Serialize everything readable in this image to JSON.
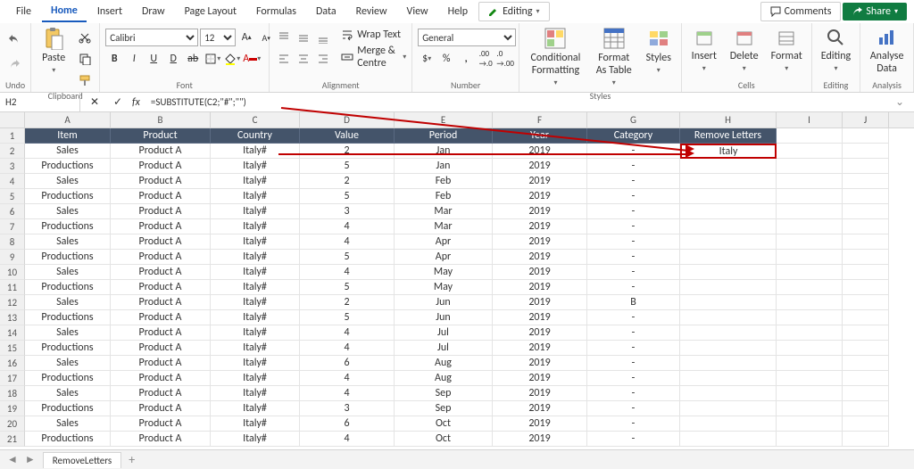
{
  "tabs": {
    "file": "File",
    "home": "Home",
    "insert": "Insert",
    "draw": "Draw",
    "pagelayout": "Page Layout",
    "formulas": "Formulas",
    "data": "Data",
    "review": "Review",
    "view": "View",
    "help": "Help",
    "editing": "Editing",
    "comments": "Comments",
    "share": "Share"
  },
  "ribbon": {
    "undo": "Undo",
    "clipboard": "Clipboard",
    "paste": "Paste",
    "font": "Font",
    "font_name": "Calibri",
    "font_size": "12",
    "alignment": "Alignment",
    "wrap": "Wrap Text",
    "merge": "Merge & Centre",
    "number": "Number",
    "number_format": "General",
    "styles": "Styles",
    "cf": "Conditional Formatting",
    "fat": "Format As Table",
    "st": "Styles",
    "cells": "Cells",
    "ins": "Insert",
    "del": "Delete",
    "fmt": "Format",
    "editing_g": "Editing",
    "ed": "Editing",
    "analysis": "Analysis",
    "ad": "Analyse Data"
  },
  "fbar": {
    "namebox": "H2",
    "formula": "=SUBSTITUTE(C2;\"#\";\"\")",
    "fx": "fx"
  },
  "cols": [
    "A",
    "B",
    "C",
    "D",
    "E",
    "F",
    "G",
    "H",
    "I",
    "J"
  ],
  "widths": [
    96,
    112,
    100,
    106,
    110,
    106,
    104,
    108,
    74,
    52
  ],
  "headers": [
    "Item",
    "Product",
    "Country",
    "Value",
    "Period",
    "Year",
    "Category",
    "Remove Letters",
    "",
    ""
  ],
  "rows": [
    [
      "Sales",
      "Product A",
      "Italy#",
      "2",
      "Jan",
      "2019",
      "-",
      "Italy",
      "",
      ""
    ],
    [
      "Productions",
      "Product A",
      "Italy#",
      "5",
      "Jan",
      "2019",
      "-",
      "",
      "",
      ""
    ],
    [
      "Sales",
      "Product A",
      "Italy#",
      "2",
      "Feb",
      "2019",
      "-",
      "",
      "",
      ""
    ],
    [
      "Productions",
      "Product A",
      "Italy#",
      "5",
      "Feb",
      "2019",
      "-",
      "",
      "",
      ""
    ],
    [
      "Sales",
      "Product A",
      "Italy#",
      "3",
      "Mar",
      "2019",
      "-",
      "",
      "",
      ""
    ],
    [
      "Productions",
      "Product A",
      "Italy#",
      "4",
      "Mar",
      "2019",
      "-",
      "",
      "",
      ""
    ],
    [
      "Sales",
      "Product A",
      "Italy#",
      "4",
      "Apr",
      "2019",
      "-",
      "",
      "",
      ""
    ],
    [
      "Productions",
      "Product A",
      "Italy#",
      "5",
      "Apr",
      "2019",
      "-",
      "",
      "",
      ""
    ],
    [
      "Sales",
      "Product A",
      "Italy#",
      "4",
      "May",
      "2019",
      "-",
      "",
      "",
      ""
    ],
    [
      "Productions",
      "Product A",
      "Italy#",
      "5",
      "May",
      "2019",
      "-",
      "",
      "",
      ""
    ],
    [
      "Sales",
      "Product A",
      "Italy#",
      "2",
      "Jun",
      "2019",
      "B",
      "",
      "",
      ""
    ],
    [
      "Productions",
      "Product A",
      "Italy#",
      "5",
      "Jun",
      "2019",
      "-",
      "",
      "",
      ""
    ],
    [
      "Sales",
      "Product A",
      "Italy#",
      "4",
      "Jul",
      "2019",
      "-",
      "",
      "",
      ""
    ],
    [
      "Productions",
      "Product A",
      "Italy#",
      "4",
      "Jul",
      "2019",
      "-",
      "",
      "",
      ""
    ],
    [
      "Sales",
      "Product A",
      "Italy#",
      "6",
      "Aug",
      "2019",
      "-",
      "",
      "",
      ""
    ],
    [
      "Productions",
      "Product A",
      "Italy#",
      "4",
      "Aug",
      "2019",
      "-",
      "",
      "",
      ""
    ],
    [
      "Sales",
      "Product A",
      "Italy#",
      "4",
      "Sep",
      "2019",
      "-",
      "",
      "",
      ""
    ],
    [
      "Productions",
      "Product A",
      "Italy#",
      "3",
      "Sep",
      "2019",
      "-",
      "",
      "",
      ""
    ],
    [
      "Sales",
      "Product A",
      "Italy#",
      "6",
      "Oct",
      "2019",
      "-",
      "",
      "",
      ""
    ],
    [
      "Productions",
      "Product A",
      "Italy#",
      "4",
      "Oct",
      "2019",
      "-",
      "",
      "",
      ""
    ]
  ],
  "sheet_tab": "RemoveLetters",
  "selected": {
    "row": 2,
    "col": 7
  }
}
